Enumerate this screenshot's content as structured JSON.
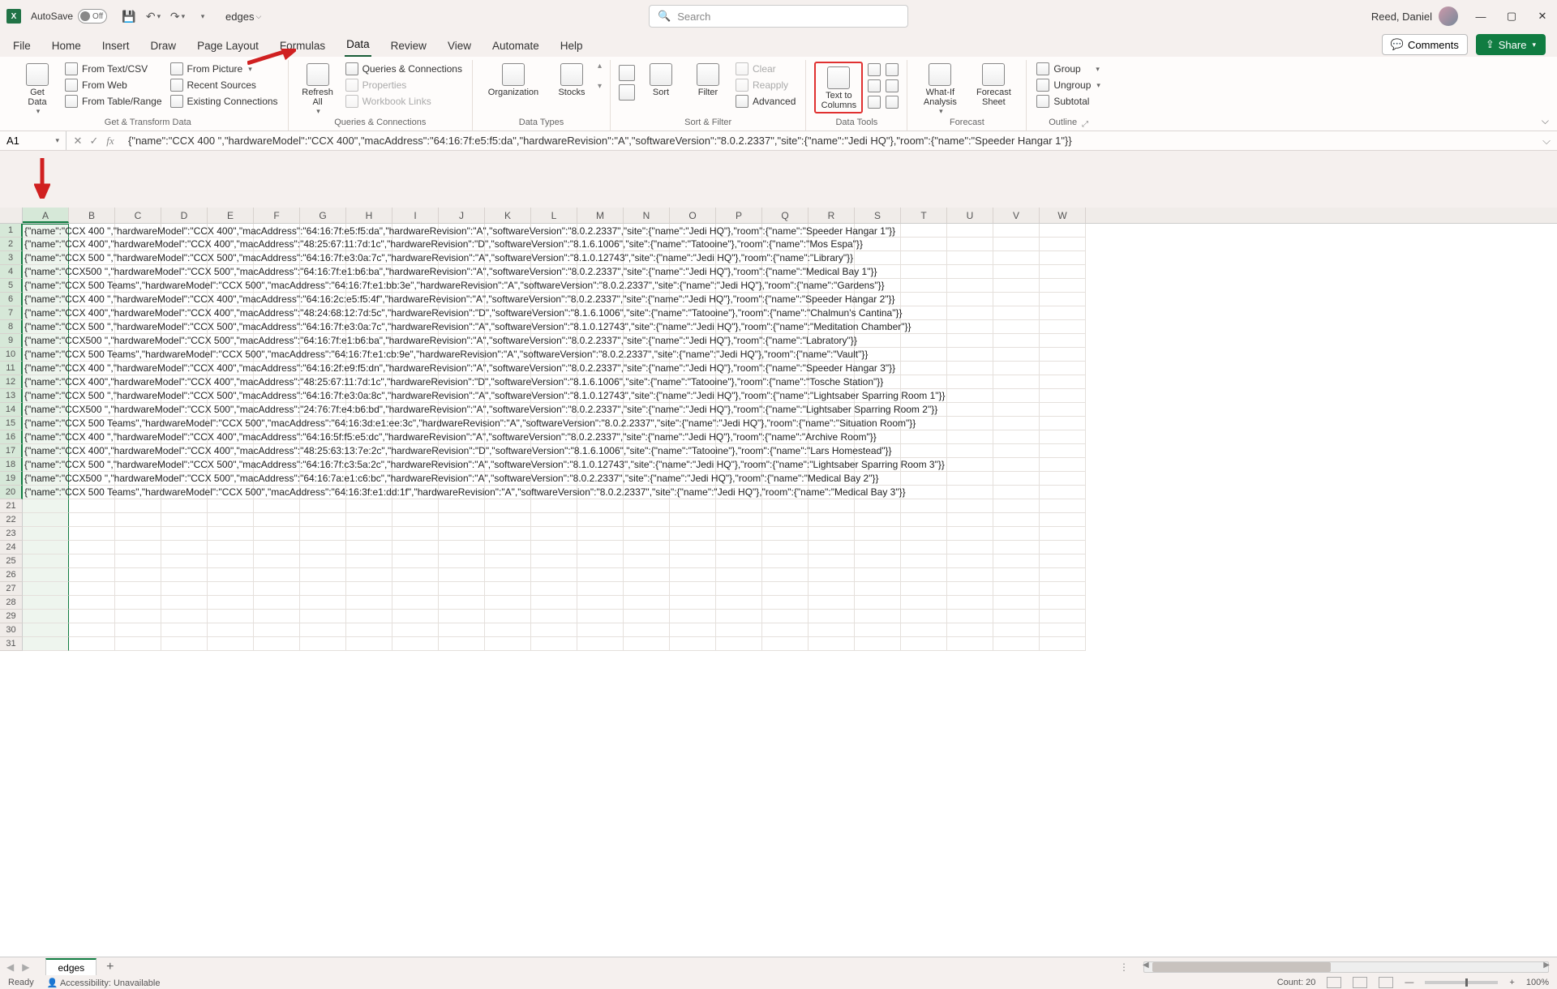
{
  "titlebar": {
    "autosave_label": "AutoSave",
    "autosave_state": "Off",
    "doc_name": "edges",
    "search_placeholder": "Search",
    "user_name": "Reed, Daniel"
  },
  "tabs": {
    "items": [
      "File",
      "Home",
      "Insert",
      "Draw",
      "Page Layout",
      "Formulas",
      "Data",
      "Review",
      "View",
      "Automate",
      "Help"
    ],
    "active": "Data",
    "comments": "Comments",
    "share": "Share"
  },
  "ribbon": {
    "get_transform": {
      "get_data": "Get\nData",
      "from_text_csv": "From Text/CSV",
      "from_web": "From Web",
      "from_table_range": "From Table/Range",
      "from_picture": "From Picture",
      "recent_sources": "Recent Sources",
      "existing_connections": "Existing Connections",
      "label": "Get & Transform Data"
    },
    "queries": {
      "refresh_all": "Refresh\nAll",
      "queries_connections": "Queries & Connections",
      "properties": "Properties",
      "workbook_links": "Workbook Links",
      "label": "Queries & Connections"
    },
    "data_types": {
      "organization": "Organization",
      "stocks": "Stocks",
      "label": "Data Types"
    },
    "sort_filter": {
      "sort": "Sort",
      "filter": "Filter",
      "clear": "Clear",
      "reapply": "Reapply",
      "advanced": "Advanced",
      "label": "Sort & Filter"
    },
    "data_tools": {
      "text_to_columns": "Text to\nColumns",
      "label": "Data Tools"
    },
    "forecast": {
      "what_if": "What-If\nAnalysis",
      "forecast_sheet": "Forecast\nSheet",
      "label": "Forecast"
    },
    "outline": {
      "group": "Group",
      "ungroup": "Ungroup",
      "subtotal": "Subtotal",
      "label": "Outline"
    }
  },
  "formula_bar": {
    "name_box": "A1",
    "formula": "{\"name\":\"CCX 400 \",\"hardwareModel\":\"CCX 400\",\"macAddress\":\"64:16:7f:e5:f5:da\",\"hardwareRevision\":\"A\",\"softwareVersion\":\"8.0.2.2337\",\"site\":{\"name\":\"Jedi HQ\"},\"room\":{\"name\":\"Speeder Hangar 1\"}}"
  },
  "columns": [
    "A",
    "B",
    "C",
    "D",
    "E",
    "F",
    "G",
    "H",
    "I",
    "J",
    "K",
    "L",
    "M",
    "N",
    "O",
    "P",
    "Q",
    "R",
    "S",
    "T",
    "U",
    "V",
    "W"
  ],
  "selected_column": "A",
  "row_count_visible": 31,
  "data_rows": [
    "{\"name\":\"CCX 400 \",\"hardwareModel\":\"CCX 400\",\"macAddress\":\"64:16:7f:e5:f5:da\",\"hardwareRevision\":\"A\",\"softwareVersion\":\"8.0.2.2337\",\"site\":{\"name\":\"Jedi HQ\"},\"room\":{\"name\":\"Speeder Hangar 1\"}}",
    "{\"name\":\"CCX 400\",\"hardwareModel\":\"CCX 400\",\"macAddress\":\"48:25:67:11:7d:1c\",\"hardwareRevision\":\"D\",\"softwareVersion\":\"8.1.6.1006\",\"site\":{\"name\":\"Tatooine\"},\"room\":{\"name\":\"Mos Espa\"}}",
    "{\"name\":\"CCX 500 \",\"hardwareModel\":\"CCX 500\",\"macAddress\":\"64:16:7f:e3:0a:7c\",\"hardwareRevision\":\"A\",\"softwareVersion\":\"8.1.0.12743\",\"site\":{\"name\":\"Jedi HQ\"},\"room\":{\"name\":\"Library\"}}",
    "{\"name\":\"CCX500 \",\"hardwareModel\":\"CCX 500\",\"macAddress\":\"64:16:7f:e1:b6:ba\",\"hardwareRevision\":\"A\",\"softwareVersion\":\"8.0.2.2337\",\"site\":{\"name\":\"Jedi HQ\"},\"room\":{\"name\":\"Medical Bay 1\"}}",
    "{\"name\":\"CCX 500  Teams\",\"hardwareModel\":\"CCX 500\",\"macAddress\":\"64:16:7f:e1:bb:3e\",\"hardwareRevision\":\"A\",\"softwareVersion\":\"8.0.2.2337\",\"site\":{\"name\":\"Jedi HQ\"},\"room\":{\"name\":\"Gardens\"}}",
    "{\"name\":\"CCX 400 \",\"hardwareModel\":\"CCX 400\",\"macAddress\":\"64:16:2c:e5:f5:4f\",\"hardwareRevision\":\"A\",\"softwareVersion\":\"8.0.2.2337\",\"site\":{\"name\":\"Jedi HQ\"},\"room\":{\"name\":\"Speeder Hangar 2\"}}",
    "{\"name\":\"CCX 400\",\"hardwareModel\":\"CCX 400\",\"macAddress\":\"48:24:68:12:7d:5c\",\"hardwareRevision\":\"D\",\"softwareVersion\":\"8.1.6.1006\",\"site\":{\"name\":\"Tatooine\"},\"room\":{\"name\":\"Chalmun's Cantina\"}}",
    "{\"name\":\"CCX 500 \",\"hardwareModel\":\"CCX 500\",\"macAddress\":\"64:16:7f:e3:0a:7c\",\"hardwareRevision\":\"A\",\"softwareVersion\":\"8.1.0.12743\",\"site\":{\"name\":\"Jedi HQ\"},\"room\":{\"name\":\"Meditation Chamber\"}}",
    "{\"name\":\"CCX500 \",\"hardwareModel\":\"CCX 500\",\"macAddress\":\"64:16:7f:e1:b6:ba\",\"hardwareRevision\":\"A\",\"softwareVersion\":\"8.0.2.2337\",\"site\":{\"name\":\"Jedi HQ\"},\"room\":{\"name\":\"Labratory\"}}",
    "{\"name\":\"CCX 500  Teams\",\"hardwareModel\":\"CCX 500\",\"macAddress\":\"64:16:7f:e1:cb:9e\",\"hardwareRevision\":\"A\",\"softwareVersion\":\"8.0.2.2337\",\"site\":{\"name\":\"Jedi HQ\"},\"room\":{\"name\":\"Vault\"}}",
    "{\"name\":\"CCX 400 \",\"hardwareModel\":\"CCX 400\",\"macAddress\":\"64:16:2f:e9:f5:dn\",\"hardwareRevision\":\"A\",\"softwareVersion\":\"8.0.2.2337\",\"site\":{\"name\":\"Jedi HQ\"},\"room\":{\"name\":\"Speeder Hangar 3\"}}",
    "{\"name\":\"CCX 400\",\"hardwareModel\":\"CCX 400\",\"macAddress\":\"48:25:67:11:7d:1c\",\"hardwareRevision\":\"D\",\"softwareVersion\":\"8.1.6.1006\",\"site\":{\"name\":\"Tatooine\"},\"room\":{\"name\":\"Tosche Station\"}}",
    "{\"name\":\"CCX 500 \",\"hardwareModel\":\"CCX 500\",\"macAddress\":\"64:16:7f:e3:0a:8c\",\"hardwareRevision\":\"A\",\"softwareVersion\":\"8.1.0.12743\",\"site\":{\"name\":\"Jedi HQ\"},\"room\":{\"name\":\"Lightsaber Sparring Room 1\"}}",
    "{\"name\":\"CCX500 \",\"hardwareModel\":\"CCX 500\",\"macAddress\":\"24:76:7f:e4:b6:bd\",\"hardwareRevision\":\"A\",\"softwareVersion\":\"8.0.2.2337\",\"site\":{\"name\":\"Jedi HQ\"},\"room\":{\"name\":\"Lightsaber Sparring Room 2\"}}",
    "{\"name\":\"CCX 500  Teams\",\"hardwareModel\":\"CCX 500\",\"macAddress\":\"64:16:3d:e1:ee:3c\",\"hardwareRevision\":\"A\",\"softwareVersion\":\"8.0.2.2337\",\"site\":{\"name\":\"Jedi HQ\"},\"room\":{\"name\":\"Situation Room\"}}",
    "{\"name\":\"CCX 400 \",\"hardwareModel\":\"CCX 400\",\"macAddress\":\"64:16:5f:f5:e5:dc\",\"hardwareRevision\":\"A\",\"softwareVersion\":\"8.0.2.2337\",\"site\":{\"name\":\"Jedi HQ\"},\"room\":{\"name\":\"Archive Room\"}}",
    "{\"name\":\"CCX 400\",\"hardwareModel\":\"CCX 400\",\"macAddress\":\"48:25:63:13:7e:2c\",\"hardwareRevision\":\"D\",\"softwareVersion\":\"8.1.6.1006\",\"site\":{\"name\":\"Tatooine\"},\"room\":{\"name\":\"Lars Homestead\"}}",
    "{\"name\":\"CCX 500 \",\"hardwareModel\":\"CCX 500\",\"macAddress\":\"64:16:7f:c3:5a:2c\",\"hardwareRevision\":\"A\",\"softwareVersion\":\"8.1.0.12743\",\"site\":{\"name\":\"Jedi HQ\"},\"room\":{\"name\":\"Lightsaber Sparring Room 3\"}}",
    "{\"name\":\"CCX500 \",\"hardwareModel\":\"CCX 500\",\"macAddress\":\"64:16:7a:e1:c6:bc\",\"hardwareRevision\":\"A\",\"softwareVersion\":\"8.0.2.2337\",\"site\":{\"name\":\"Jedi HQ\"},\"room\":{\"name\":\"Medical Bay 2\"}}",
    "{\"name\":\"CCX 500  Teams\",\"hardwareModel\":\"CCX 500\",\"macAddress\":\"64:16:3f:e1:dd:1f\",\"hardwareRevision\":\"A\",\"softwareVersion\":\"8.0.2.2337\",\"site\":{\"name\":\"Jedi HQ\"},\"room\":{\"name\":\"Medical Bay 3\"}}"
  ],
  "sheet": {
    "name": "edges"
  },
  "status": {
    "ready": "Ready",
    "accessibility": "Accessibility: Unavailable",
    "count": "Count: 20",
    "zoom": "100%"
  }
}
